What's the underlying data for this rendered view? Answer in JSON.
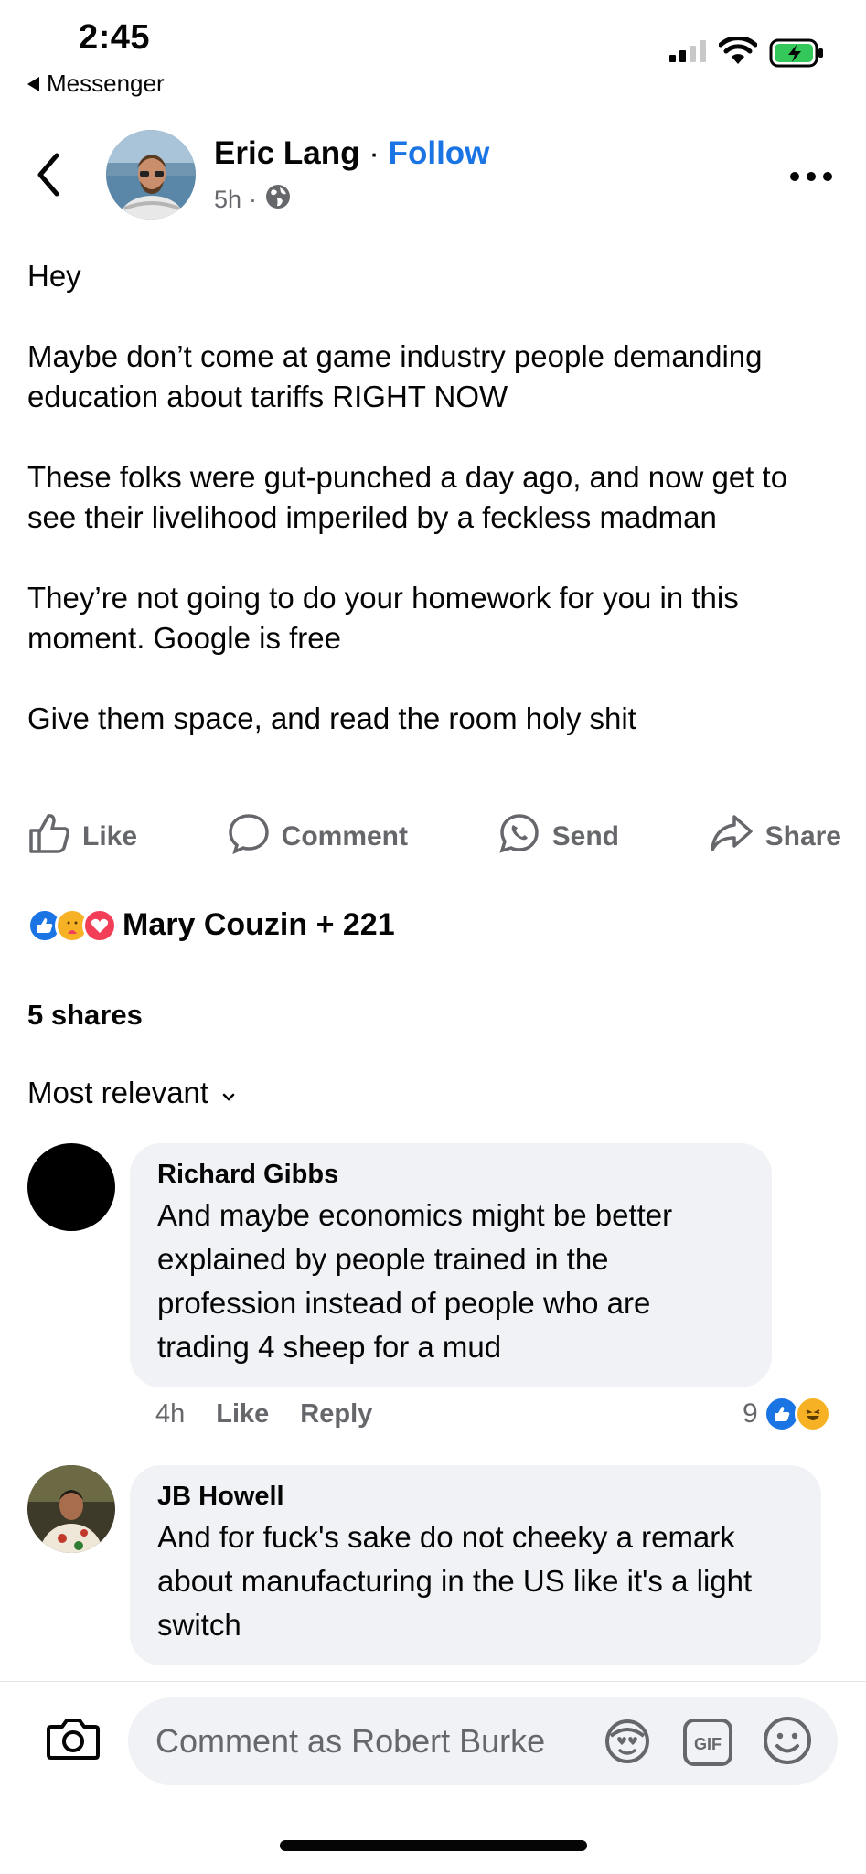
{
  "status_bar": {
    "time": "2:45",
    "back_app": "Messenger"
  },
  "post": {
    "author": "Eric Lang",
    "separator": " · ",
    "follow": "Follow",
    "age": "5h",
    "meta_sep": "·",
    "privacy_icon": "globe-icon",
    "paragraphs": [
      "Hey",
      "Maybe don’t come at game industry people demanding education about tariffs RIGHT NOW",
      "These folks were gut-punched a day ago, and now get to see their livelihood imperiled by a feckless madman",
      "They’re not going to do your homework for you in this moment. Google is free",
      "Give them space, and read the room holy shit"
    ],
    "actions": {
      "like": "Like",
      "comment": "Comment",
      "send": "Send",
      "share": "Share"
    },
    "reactions_text": "Mary Couzin + 221",
    "shares_text": "5 shares",
    "sort_label": "Most relevant"
  },
  "comments": [
    {
      "name": "Richard Gibbs",
      "text": "And maybe economics might be better explained by people trained in the profession instead of people who are trading 4 sheep for a mud",
      "time": "4h",
      "like": "Like",
      "reply": "Reply",
      "reaction_count": "9"
    },
    {
      "name": "JB Howell",
      "text": "And for fuck's sake do not cheeky a remark about manufacturing in the US like it's a light switch"
    }
  ],
  "composer": {
    "placeholder": "Comment as Robert Burke",
    "gif_label": "GIF"
  },
  "colors": {
    "accent": "#1b74e4",
    "secondary_text": "#65676b",
    "bubble": "#f0f2f5",
    "love": "#f33e58",
    "battery": "#34c759"
  }
}
